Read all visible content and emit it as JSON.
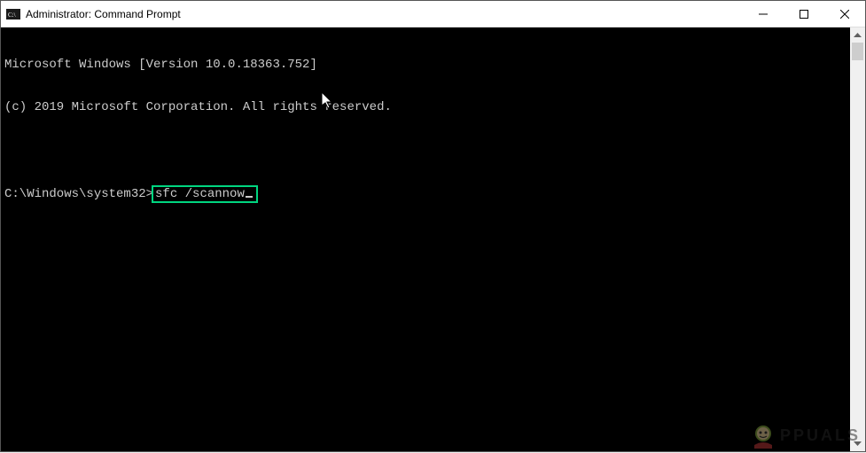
{
  "titlebar": {
    "title": "Administrator: Command Prompt"
  },
  "terminal": {
    "line1": "Microsoft Windows [Version 10.0.18363.752]",
    "line2": "(c) 2019 Microsoft Corporation. All rights reserved.",
    "prompt": "C:\\Windows\\system32>",
    "command": "sfc /scannow"
  },
  "watermark": {
    "text": "PPUALS"
  }
}
